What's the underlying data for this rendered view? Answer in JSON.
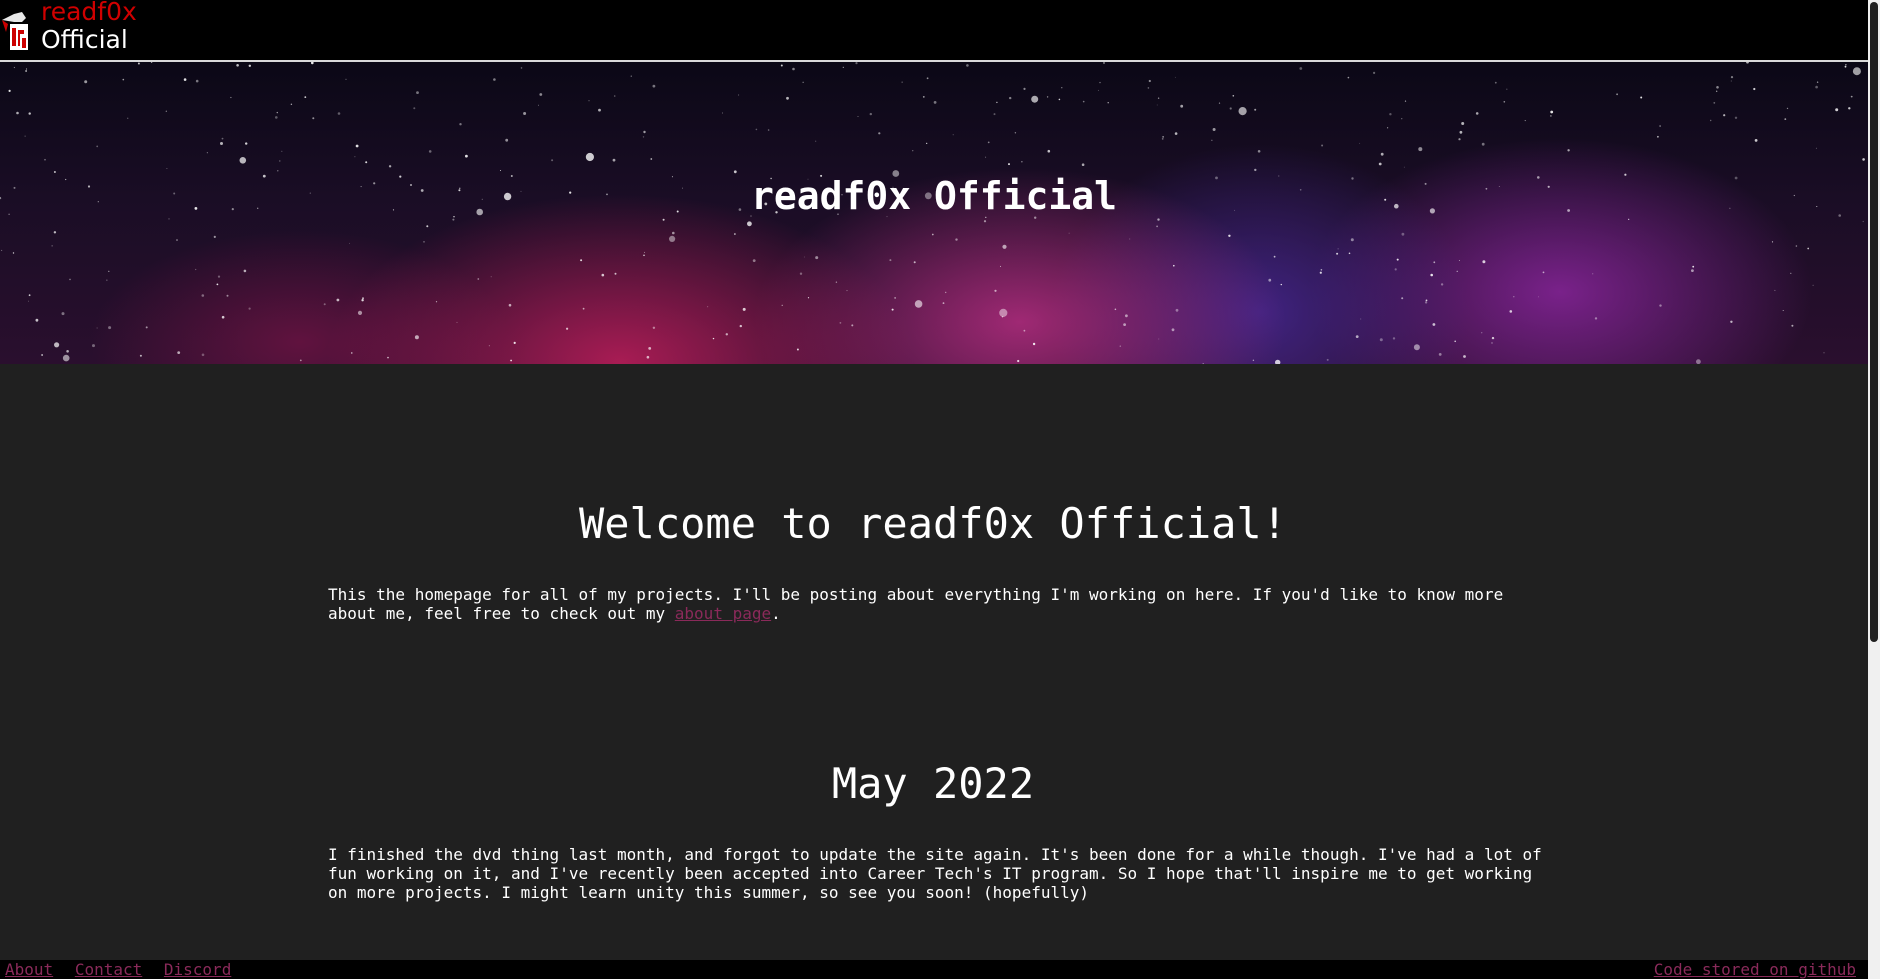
{
  "header": {
    "logo_line1": "readf0x",
    "logo_line2": "Official",
    "logo_icon": "fox-icon"
  },
  "hero": {
    "title": "readf0x Official"
  },
  "welcome": {
    "title": "Welcome to readf0x Official!",
    "body_before_link": "This the homepage for all of my projects. I'll be posting about everything I'm working on here. If you'd like to know more\nabout me, feel free to check out my ",
    "link_text": "about page",
    "body_after_link": "."
  },
  "post": {
    "title": "May 2022",
    "body": "I finished the dvd thing last month, and forgot to update the site again. It's been done for a while though. I've had a lot of\nfun working on it, and I've recently been accepted into Career Tech's IT program. So I hope that'll inspire me to get working\non more projects. I might learn unity this summer, so see you soon! (hopefully)"
  },
  "footer": {
    "links": [
      "About",
      "Contact",
      "Discord"
    ],
    "right_link": "Code stored on github"
  },
  "colors": {
    "background": "#202020",
    "topbar": "#000000",
    "brand_red": "#d00000",
    "link": "#8a2a5a"
  }
}
